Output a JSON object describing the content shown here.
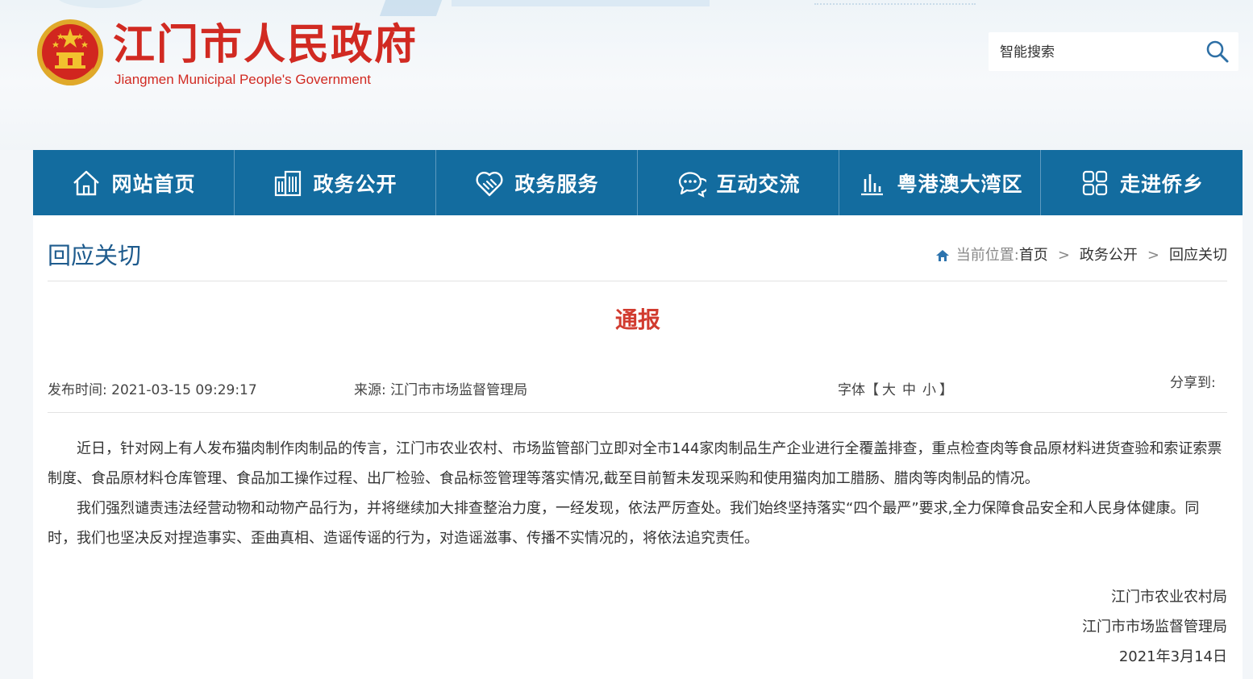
{
  "header": {
    "logo_cn": "江门市人民政府",
    "logo_en": "Jiangmen Municipal People's Government",
    "search_placeholder": "智能搜索"
  },
  "nav": {
    "items": [
      {
        "label": "网站首页",
        "icon": "home-icon"
      },
      {
        "label": "政务公开",
        "icon": "building-icon"
      },
      {
        "label": "政务服务",
        "icon": "handshake-heart-icon"
      },
      {
        "label": "互动交流",
        "icon": "chat-icon"
      },
      {
        "label": "粤港澳大湾区",
        "icon": "bar-chart-icon"
      },
      {
        "label": "走进侨乡",
        "icon": "grid-icon"
      }
    ]
  },
  "section": {
    "title": "回应关切",
    "breadcrumb": {
      "label": "当前位置:",
      "items": [
        "首页",
        "政务公开",
        "回应关切"
      ],
      "separator": ">"
    }
  },
  "article": {
    "title": "通报",
    "publish_label": "发布时间:",
    "publish_time": "2021-03-15 09:29:17",
    "source_label": "来源:",
    "source": "江门市市场监督管理局",
    "font_label": "字体",
    "font_open": "【",
    "font_sizes": [
      "大",
      "中",
      "小"
    ],
    "font_close": "】",
    "share_label": "分享到:",
    "paragraphs": [
      "近日，针对网上有人发布猫肉制作肉制品的传言，江门市农业农村、市场监管部门立即对全市144家肉制品生产企业进行全覆盖排查，重点检查肉等食品原材料进货查验和索证索票制度、食品原材料仓库管理、食品加工操作过程、出厂检验、食品标签管理等落实情况,截至目前暂未发现采购和使用猫肉加工腊肠、腊肉等肉制品的情况。",
      "我们强烈谴责违法经营动物和动物产品行为，并将继续加大排查整治力度，一经发现，依法严厉查处。我们始终坚持落实“四个最严”要求,全力保障食品安全和人民身体健康。同时，我们也坚决反对捏造事实、歪曲真相、造谣传谣的行为，对造谣滋事、传播不实情况的，将依法追究责任。"
    ],
    "signatures": [
      "江门市农业农村局",
      "江门市市场监督管理局",
      "2021年3月14日"
    ]
  },
  "colors": {
    "nav_bg": "#136c9f",
    "logo_red": "#d12a22",
    "title_red": "#d13b2f",
    "section_blue": "#1e5b8d"
  }
}
